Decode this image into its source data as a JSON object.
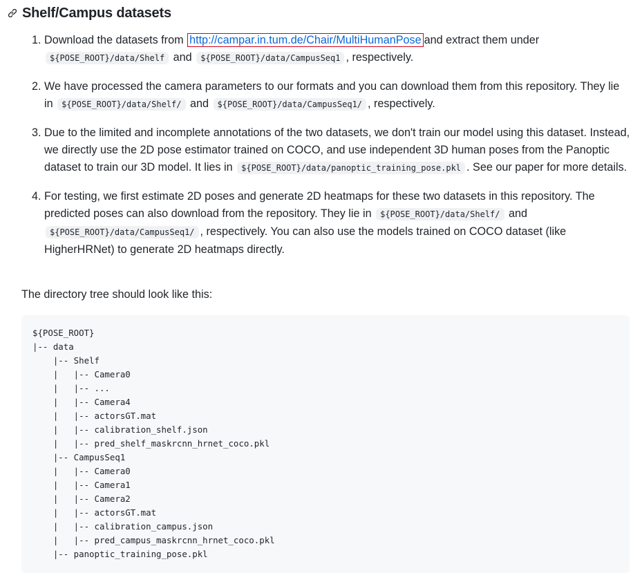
{
  "heading": {
    "icon": "link-icon",
    "title": "Shelf/Campus datasets"
  },
  "steps": [
    {
      "num": "1.",
      "text_a": "Download the datasets from",
      "link": "http://campar.in.tum.de/Chair/MultiHumanPose",
      "text_b": "and extract them under",
      "code_a": "${POSE_ROOT}/data/Shelf",
      "text_c": "and",
      "code_b": "${POSE_ROOT}/data/CampusSeq1",
      "text_d": ", respectively."
    },
    {
      "num": "2.",
      "text_a": "We have processed the camera parameters to our formats and you can download them from this repository. They lie in",
      "code_a": "${POSE_ROOT}/data/Shelf/",
      "text_b": "and",
      "code_b": "${POSE_ROOT}/data/CampusSeq1/",
      "text_c": ", respectively."
    },
    {
      "num": "3.",
      "text_a": "Due to the limited and incomplete annotations of the two datasets, we don't train our model using this dataset. Instead, we directly use the 2D pose estimator trained on COCO, and use independent 3D human poses from the Panoptic dataset to train our 3D model. It lies in",
      "code_a": "${POSE_ROOT}/data/panoptic_training_pose.pkl",
      "text_b": ". See our paper for more details."
    },
    {
      "num": "4.",
      "text_a": "For testing, we first estimate 2D poses and generate 2D heatmaps for these two datasets in this repository. The predicted poses can also download from the repository. They lie in",
      "code_a": "${POSE_ROOT}/data/Shelf/",
      "text_b": "and",
      "code_b": "${POSE_ROOT}/data/CampusSeq1/",
      "text_c": ", respectively. You can also use the models trained on COCO dataset (like HigherHRNet) to generate 2D heatmaps directly."
    }
  ],
  "intro": "The directory tree should look like this:",
  "tree": "${POSE_ROOT}\n|-- data\n    |-- Shelf\n    |   |-- Camera0\n    |   |-- ...\n    |   |-- Camera4\n    |   |-- actorsGT.mat\n    |   |-- calibration_shelf.json\n    |   |-- pred_shelf_maskrcnn_hrnet_coco.pkl\n    |-- CampusSeq1\n    |   |-- Camera0\n    |   |-- Camera1\n    |   |-- Camera2\n    |   |-- actorsGT.mat\n    |   |-- calibration_campus.json\n    |   |-- pred_campus_maskrcnn_hrnet_coco.pkl\n    |-- panoptic_training_pose.pkl"
}
